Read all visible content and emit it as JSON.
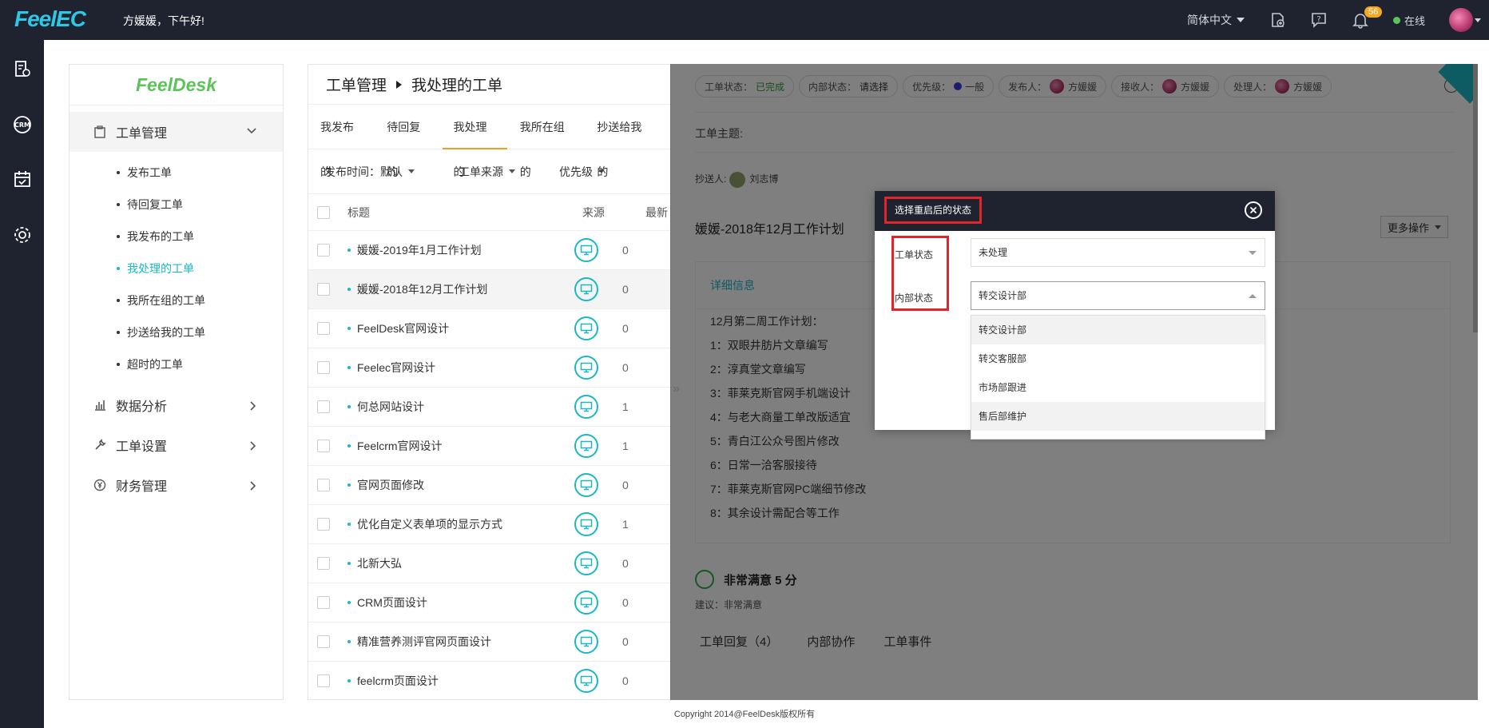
{
  "topbar": {
    "logo": "FeelEC",
    "greeting": "方媛媛，下午好!",
    "language": "简体中文",
    "notification_count": "56",
    "status": "在线"
  },
  "rail": {
    "items": [
      {
        "icon": "ticket-settings-icon"
      },
      {
        "icon": "crm-icon",
        "text": "CRM"
      },
      {
        "icon": "calendar-check-icon"
      },
      {
        "icon": "gear-icon"
      }
    ]
  },
  "sidebar": {
    "logo": "FeelDesk",
    "groups": [
      {
        "label": "工单管理",
        "icon": "clipboard-icon"
      },
      {
        "label": "数据分析",
        "icon": "bar-chart-icon"
      },
      {
        "label": "工单设置",
        "icon": "wrench-icon"
      },
      {
        "label": "财务管理",
        "icon": "yen-icon"
      }
    ],
    "sub_items": [
      "发布工单",
      "待回复工单",
      "我发布的工单",
      "我处理的工单",
      "我所在组的工单",
      "抄送给我的工单",
      "超时的工单"
    ]
  },
  "main": {
    "breadcrumb": {
      "root": "工单管理",
      "current": "我处理的工单"
    },
    "tabs": [
      "我发布的",
      "待回复的",
      "我处理的",
      "我所在组的",
      "抄送给我的"
    ],
    "filters": [
      "发布时间：默认",
      "工单来源",
      "优先级"
    ],
    "columns": [
      "标题",
      "来源",
      "最新"
    ],
    "rows": [
      {
        "title": "媛媛-2019年1月工作计划",
        "last": "0"
      },
      {
        "title": "媛媛-2018年12月工作计划",
        "last": "0"
      },
      {
        "title": "FeelDesk官网设计",
        "last": "0"
      },
      {
        "title": "Feelec官网设计",
        "last": "0"
      },
      {
        "title": "何总网站设计",
        "last": "1"
      },
      {
        "title": "Feelcrm官网设计",
        "last": "1"
      },
      {
        "title": "官网页面修改",
        "last": "0"
      },
      {
        "title": "优化自定义表单项的显示方式",
        "last": "1"
      },
      {
        "title": "北新大弘",
        "last": "0"
      },
      {
        "title": "CRM页面设计",
        "last": "0"
      },
      {
        "title": "精准营养测评官网页面设计",
        "last": "0"
      },
      {
        "title": "feelcrm页面设计",
        "last": "0"
      }
    ]
  },
  "detail": {
    "pills": [
      {
        "label": "工单状态：",
        "value": "已完成"
      },
      {
        "label": "内部状态：",
        "value": "请选择"
      },
      {
        "label": "优先级：",
        "value": "一般"
      },
      {
        "label": "发布人：",
        "value": "方媛媛"
      },
      {
        "label": "接收人：",
        "value": "方媛媛"
      },
      {
        "label": "处理人：",
        "value": "方媛媛"
      }
    ],
    "subject_label": "工单主题:",
    "cc_label": "抄送人:",
    "cc_name": "刘志博",
    "title": "媛媛-2018年12月工作计划",
    "more_button": "更多操作",
    "info_header": "详细信息",
    "info_lines": [
      "12月第二周工作计划：",
      "1：双眼井肪片文章编写",
      "2：淳真堂文章编写",
      "3：菲莱克斯官网手机端设计",
      "4：与老大商量工单改版适宜",
      "5：青白江公众号图片修改",
      "6：日常一洽客服接待",
      "7：菲莱克斯官网PC端细节修改",
      "8：其余设计需配合等工作"
    ],
    "satisfaction": "非常满意 5 分",
    "suggestion": "建议：非常满意",
    "bottom_tabs": [
      "工单回复（4）",
      "内部协作",
      "工单事件"
    ]
  },
  "modal": {
    "title": "选择重启后的状态",
    "label_status": "工单状态",
    "label_internal": "内部状态",
    "status_value": "未处理",
    "internal_value": "转交设计部",
    "options": [
      "转交设计部",
      "转交客服部",
      "市场部跟进",
      "售后部维护"
    ]
  },
  "footer": "Copyright 2014@FeelDesk版权所有",
  "colors": {
    "accent": "#1bb7c7",
    "tab_underline": "#f19e22",
    "highlight_border": "#e1262b",
    "dark": "#1f2330"
  }
}
